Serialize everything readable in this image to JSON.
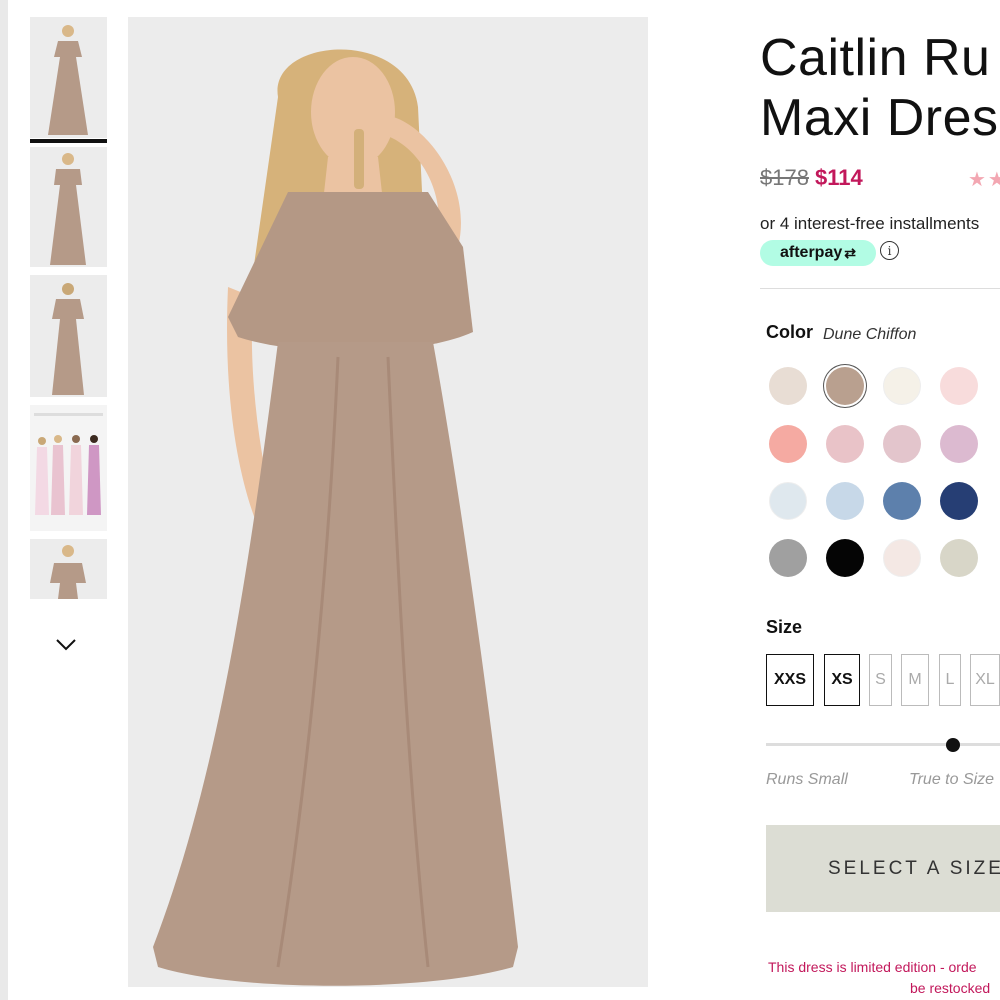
{
  "product": {
    "title_line1": "Caitlin Ru",
    "title_line2": "Maxi Dres",
    "price_original": "$178",
    "price_sale": "$114",
    "rating_stars": "★★",
    "installments_text": "or 4 interest-free installments",
    "afterpay_label": "afterpay",
    "afterpay_icon": "⇄",
    "info_icon": "i"
  },
  "color": {
    "label": "Color",
    "selected_value": "Dune Chiffon",
    "swatches": [
      {
        "name": "swatch-1",
        "color": "#e8ddd4"
      },
      {
        "name": "swatch-2",
        "color": "#b9a08f"
      },
      {
        "name": "swatch-3",
        "color": "#f5f1e8"
      },
      {
        "name": "swatch-4",
        "color": "#f8dcdc"
      },
      {
        "name": "swatch-5",
        "color": "#f5aaa2"
      },
      {
        "name": "swatch-6",
        "color": "#e9c3c8"
      },
      {
        "name": "swatch-7",
        "color": "#e3c5cc"
      },
      {
        "name": "swatch-8",
        "color": "#dcbad0"
      },
      {
        "name": "swatch-9",
        "color": "#dfe8ee"
      },
      {
        "name": "swatch-10",
        "color": "#c7d8e8"
      },
      {
        "name": "swatch-11",
        "color": "#5d80ac"
      },
      {
        "name": "swatch-12",
        "color": "#263e74"
      },
      {
        "name": "swatch-13",
        "color": "#a0a0a0"
      },
      {
        "name": "swatch-14",
        "color": "#050505"
      },
      {
        "name": "swatch-15",
        "color": "#f4e8e4"
      },
      {
        "name": "swatch-16",
        "color": "#d8d6c8"
      }
    ]
  },
  "size": {
    "label": "Size",
    "options": [
      {
        "label": "XXS",
        "available": true
      },
      {
        "label": "XS",
        "available": true
      },
      {
        "label": "S",
        "available": false
      },
      {
        "label": "M",
        "available": false
      },
      {
        "label": "L",
        "available": false
      },
      {
        "label": "XL",
        "available": false
      }
    ]
  },
  "fit": {
    "left_label": "Runs Small",
    "right_label": "True to Size",
    "level": 0.8
  },
  "cta": {
    "select_size_label": "SELECT A SIZE"
  },
  "notice": {
    "line1": "This dress is limited edition - orde",
    "line2": "be restocked"
  },
  "colors": {
    "dress": "#b59a88",
    "price_sale": "#c2185b",
    "afterpay_bg": "#b2fce4",
    "cta_bg": "#dcddd4"
  }
}
